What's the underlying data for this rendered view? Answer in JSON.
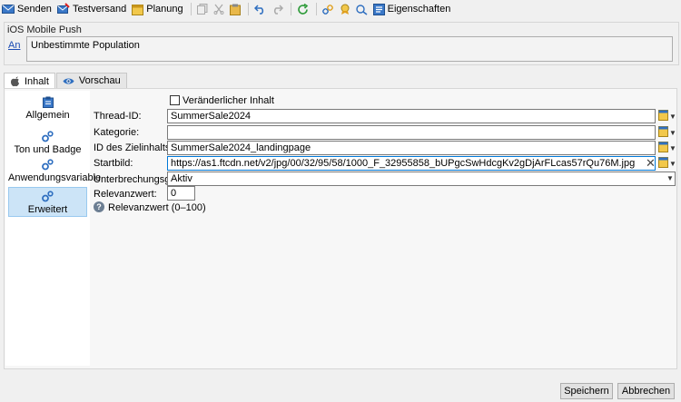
{
  "toolbar": {
    "send": "Senden",
    "test": "Testversand",
    "schedule": "Planung",
    "properties": "Eigenschaften"
  },
  "header": {
    "title": "iOS Mobile Push",
    "link": "An",
    "population": "Unbestimmte Population"
  },
  "tabs": {
    "content": "Inhalt",
    "preview": "Vorschau"
  },
  "left_nav": {
    "general": "Allgemein",
    "sound": "Ton und Badge",
    "appvar": "Anwendungsvariable",
    "advanced": "Erweitert"
  },
  "form": {
    "variable_content": "Veränderlicher Inhalt",
    "thread_label": "Thread-ID:",
    "thread_value": "SummerSale2024",
    "category_label": "Kategorie:",
    "category_value": "",
    "target_label": "ID des Zielinhalts:",
    "target_value": "SummerSale2024_landingpage",
    "image_label": "Startbild:",
    "image_value": "https://as1.ftcdn.net/v2/jpg/00/32/95/58/1000_F_32955858_bUPgcSwHdcgKv2gDjArFLcas57rQu76M.jpg",
    "interrupt_label": "Unterbrechungsgrad:",
    "interrupt_value": "Aktiv",
    "relevance_label": "Relevanzwert:",
    "relevance_value": "0",
    "help": "Relevanzwert (0–100)"
  },
  "buttons": {
    "save": "Speichern",
    "cancel": "Abbrechen"
  }
}
